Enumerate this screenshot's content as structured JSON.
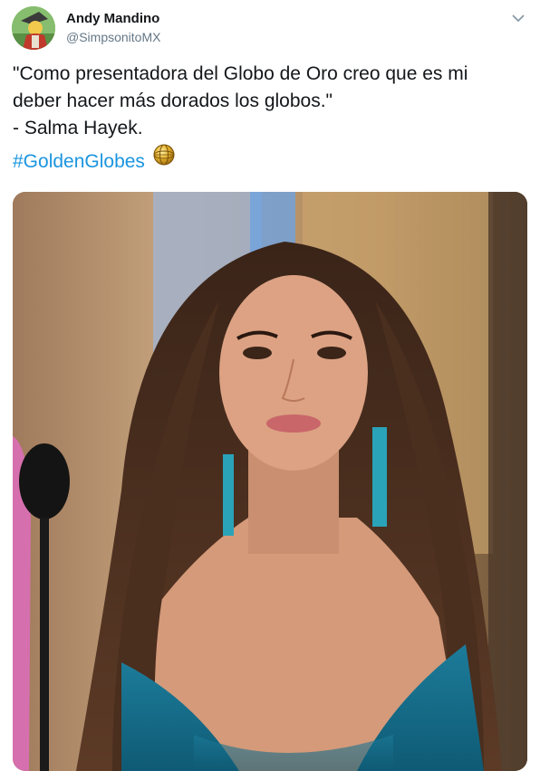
{
  "tweet": {
    "author_name": "Andy Mandino",
    "author_handle": "@SimpsonitoMX",
    "text_lines": [
      "\"Como presentadora del Globo de Oro creo que es mi",
      "deber hacer más dorados los globos.\"",
      "- Salma Hayek."
    ],
    "hashtag": "#GoldenGlobes",
    "hashtag_emoji_icon": "golden-globe-icon",
    "menu_icon": "chevron-down-icon"
  },
  "colors": {
    "link": "#1b95e0",
    "text": "#14171a",
    "secondary": "#657786"
  }
}
